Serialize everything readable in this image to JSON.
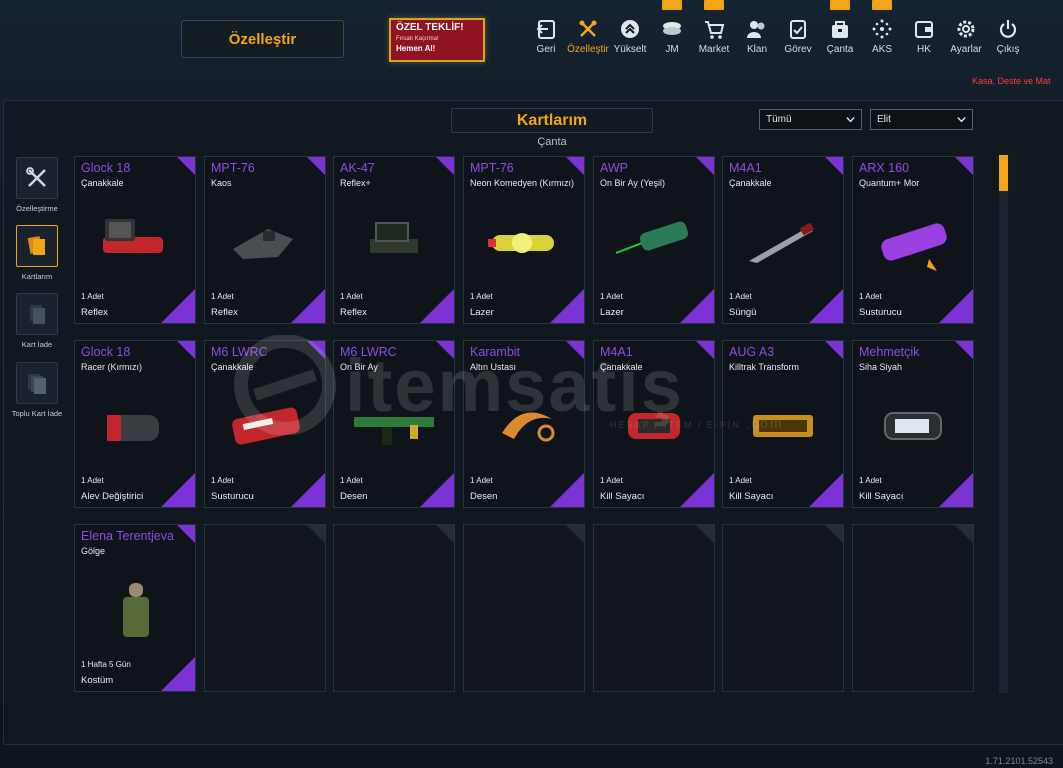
{
  "header": {
    "title": "Özelleştir",
    "offer": {
      "title": "ÖZEL TEKLİF!",
      "subtitle": "Fırsatı Kaçırma!",
      "cta": "Hemen Al!"
    },
    "nav": [
      {
        "label": "Geri",
        "icon": "back-icon",
        "badge": false
      },
      {
        "label": "Özelleştir",
        "icon": "customize-icon",
        "badge": false
      },
      {
        "label": "Yükselt",
        "icon": "upgrade-icon",
        "badge": false
      },
      {
        "label": "JM",
        "icon": "coins-icon",
        "badge": true
      },
      {
        "label": "Market",
        "icon": "cart-icon",
        "badge": true
      },
      {
        "label": "Klan",
        "icon": "clan-icon",
        "badge": false
      },
      {
        "label": "Görev",
        "icon": "mission-icon",
        "badge": false
      },
      {
        "label": "Çanta",
        "icon": "bag-icon",
        "badge": true
      },
      {
        "label": "AKS",
        "icon": "aks-icon",
        "badge": true
      },
      {
        "label": "HK",
        "icon": "wallet-icon",
        "badge": false
      },
      {
        "label": "Ayarlar",
        "icon": "gear-icon",
        "badge": false
      },
      {
        "label": "Çıkış",
        "icon": "power-icon",
        "badge": false
      }
    ],
    "promo_text": "Kasa, Deste ve Mat"
  },
  "panel": {
    "title": "Kartlarım",
    "subtitle": "Çanta",
    "filter1": "Tümü",
    "filter2": "Elit"
  },
  "sidebar": [
    {
      "label": "Özelleştirme",
      "icon": "tools-icon",
      "active": false
    },
    {
      "label": "Kartlarım",
      "icon": "cards-icon",
      "active": true
    },
    {
      "label": "Kart İade",
      "icon": "card-return-icon",
      "active": false
    },
    {
      "label": "Toplu Kart İade",
      "icon": "bulk-card-return-icon",
      "active": false
    }
  ],
  "cards": [
    {
      "name": "Glock 18",
      "sub": "Çanakkale",
      "qty": "1 Adet",
      "type": "Reflex",
      "art": "reflex-sight",
      "color": "#c1272d"
    },
    {
      "name": "MPT-76",
      "sub": "Kaos",
      "qty": "1 Adet",
      "type": "Reflex",
      "art": "reflex-dark",
      "color": "#4a4d52"
    },
    {
      "name": "AK-47",
      "sub": "Reflex+",
      "qty": "1 Adet",
      "type": "Reflex",
      "art": "reflex-green",
      "color": "#2f3a2c"
    },
    {
      "name": "MPT-76",
      "sub": "Neon Komedyen (Kırmızı)",
      "qty": "1 Adet",
      "type": "Lazer",
      "art": "laser-yellow",
      "color": "#d9d23a"
    },
    {
      "name": "AWP",
      "sub": "On Bir Ay (Yeşil)",
      "qty": "1 Adet",
      "type": "Lazer",
      "art": "laser-green",
      "color": "#2c7a56"
    },
    {
      "name": "M4A1",
      "sub": "Çanakkale",
      "qty": "1 Adet",
      "type": "Süngü",
      "art": "bayonet",
      "color": "#9aa0a6"
    },
    {
      "name": "ARX 160",
      "sub": "Quantum+ Mor",
      "qty": "1 Adet",
      "type": "Susturucu",
      "art": "silencer-purple",
      "color": "#9a3fe0"
    },
    {
      "name": "Glock 18",
      "sub": "Racer (Kırmızı)",
      "qty": "1 Adet",
      "type": "Alev Değiştirici",
      "art": "flash-hider",
      "color": "#3a3d42"
    },
    {
      "name": "M6 LWRC",
      "sub": "Çanakkale",
      "qty": "1 Adet",
      "type": "Susturucu",
      "art": "silencer-red",
      "color": "#c1272d"
    },
    {
      "name": "M6 LWRC",
      "sub": "On Bir Ay",
      "qty": "1 Adet",
      "type": "Desen",
      "art": "rifle",
      "color": "#2d7a3a"
    },
    {
      "name": "Karambit",
      "sub": "Altın Ustası",
      "qty": "1 Adet",
      "type": "Desen",
      "art": "karambit",
      "color": "#d98a2a"
    },
    {
      "name": "M4A1",
      "sub": "Çanakkale",
      "qty": "1 Adet",
      "type": "Kill Sayacı",
      "art": "counter-red",
      "color": "#c1272d"
    },
    {
      "name": "AUG A3",
      "sub": "Killtrak Transform",
      "qty": "1 Adet",
      "type": "Kill Sayacı",
      "art": "counter-gold",
      "color": "#c98e1a"
    },
    {
      "name": "Mehmetçik",
      "sub": "Siha Siyah",
      "qty": "1 Adet",
      "type": "Kill Sayacı",
      "art": "counter-black",
      "color": "#2a2d31"
    },
    {
      "name": "Elena Terentjeva",
      "sub": "Gölge",
      "qty": "1 Hafta 5 Gün",
      "type": "Kostüm",
      "art": "costume",
      "color": "#5a6b3a"
    }
  ],
  "empty_slots": 6,
  "version": "1.71.2101.52543",
  "watermark": {
    "brand": "itemsatış",
    "tagline": "HESAP / İTEM / E-PİN",
    "tld": ".com"
  },
  "colors": {
    "accent": "#f2a516",
    "rarity": "#7b33d6",
    "promo": "#ff3b3b"
  }
}
